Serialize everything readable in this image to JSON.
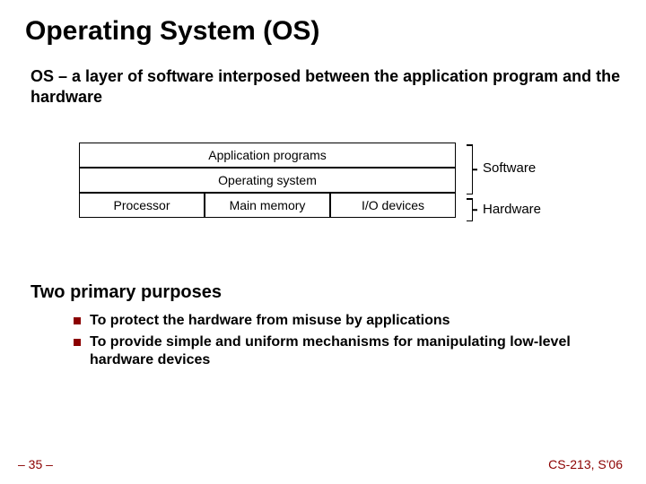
{
  "title": "Operating System (OS)",
  "definition": "OS – a layer of software interposed between the application program and the hardware",
  "diagram": {
    "row1": "Application programs",
    "row2": "Operating system",
    "row3": {
      "a": "Processor",
      "b": "Main memory",
      "c": "I/O devices"
    },
    "label_soft": "Software",
    "label_hard": "Hardware"
  },
  "purposes": {
    "heading": "Two primary purposes",
    "items": [
      "To protect the hardware from misuse by applications",
      "To provide simple and uniform mechanisms for manipulating low-level hardware devices"
    ]
  },
  "footer": {
    "left": "– 35 –",
    "right": "CS-213, S'06"
  }
}
